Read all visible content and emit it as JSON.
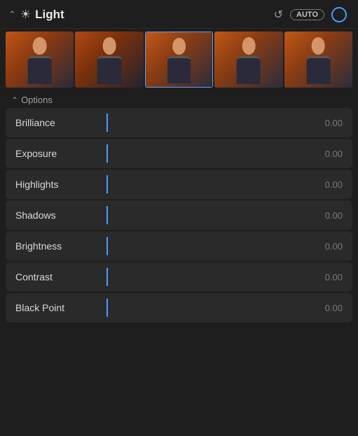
{
  "header": {
    "title": "Light",
    "auto_label": "AUTO",
    "undo_unicode": "↺"
  },
  "options": {
    "label": "Options"
  },
  "sliders": [
    {
      "label": "Brilliance",
      "value": "0.00"
    },
    {
      "label": "Exposure",
      "value": "0.00"
    },
    {
      "label": "Highlights",
      "value": "0.00"
    },
    {
      "label": "Shadows",
      "value": "0.00"
    },
    {
      "label": "Brightness",
      "value": "0.00"
    },
    {
      "label": "Contrast",
      "value": "0.00"
    },
    {
      "label": "Black Point",
      "value": "0.00"
    }
  ],
  "colors": {
    "accent": "#4a9eff",
    "bg": "#1e1e1e",
    "row_bg": "#2a2a2a"
  }
}
